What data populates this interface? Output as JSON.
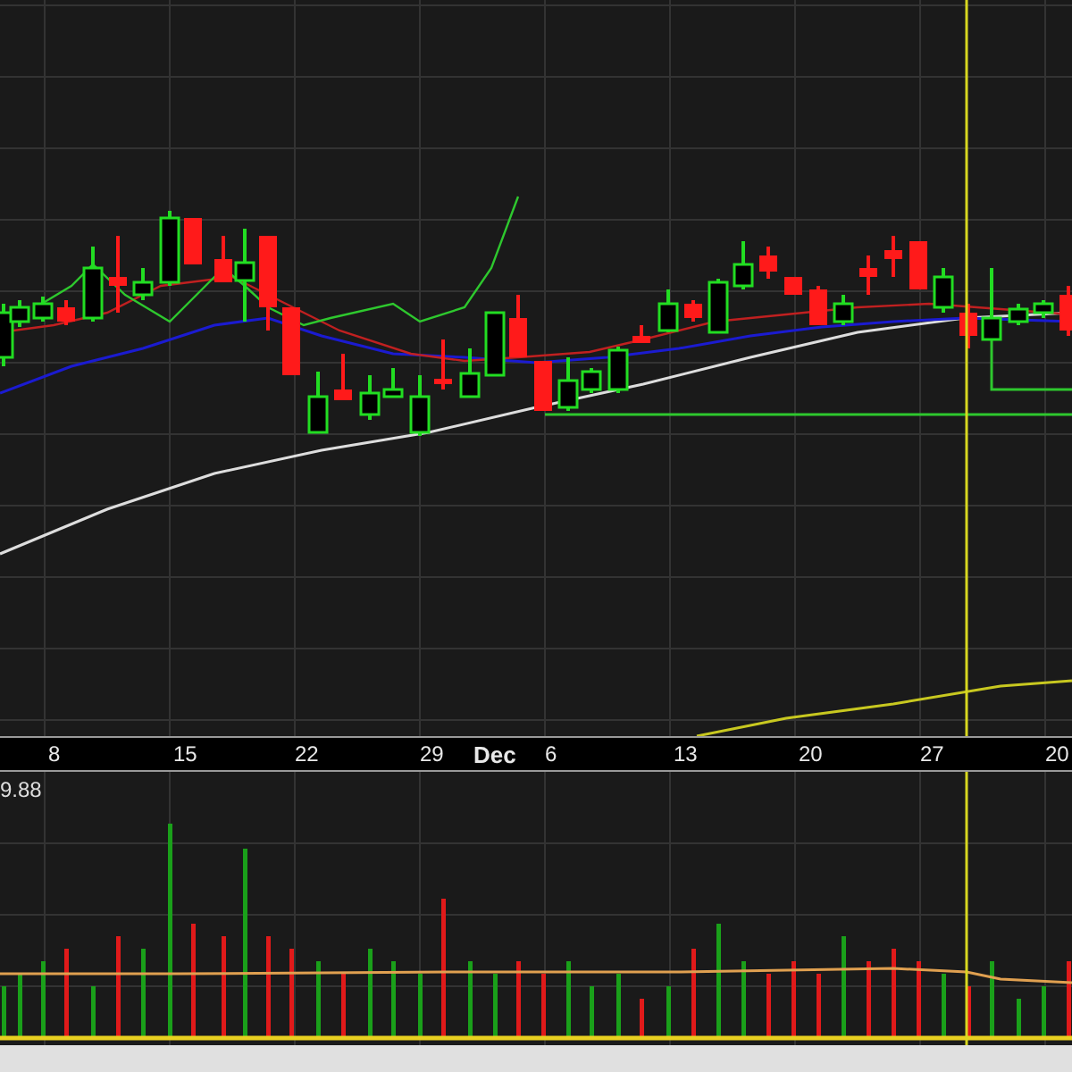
{
  "date_axis": {
    "labels": [
      {
        "text": "8",
        "kind": "day"
      },
      {
        "text": "15",
        "kind": "day"
      },
      {
        "text": "22",
        "kind": "day"
      },
      {
        "text": "29",
        "kind": "day"
      },
      {
        "text": "Dec",
        "kind": "month"
      },
      {
        "text": "6",
        "kind": "day"
      },
      {
        "text": "13",
        "kind": "day"
      },
      {
        "text": "20",
        "kind": "day"
      },
      {
        "text": "27",
        "kind": "day"
      },
      {
        "text": "20",
        "kind": "day"
      }
    ]
  },
  "volume_panel": {
    "scale_label": "9.88"
  }
}
